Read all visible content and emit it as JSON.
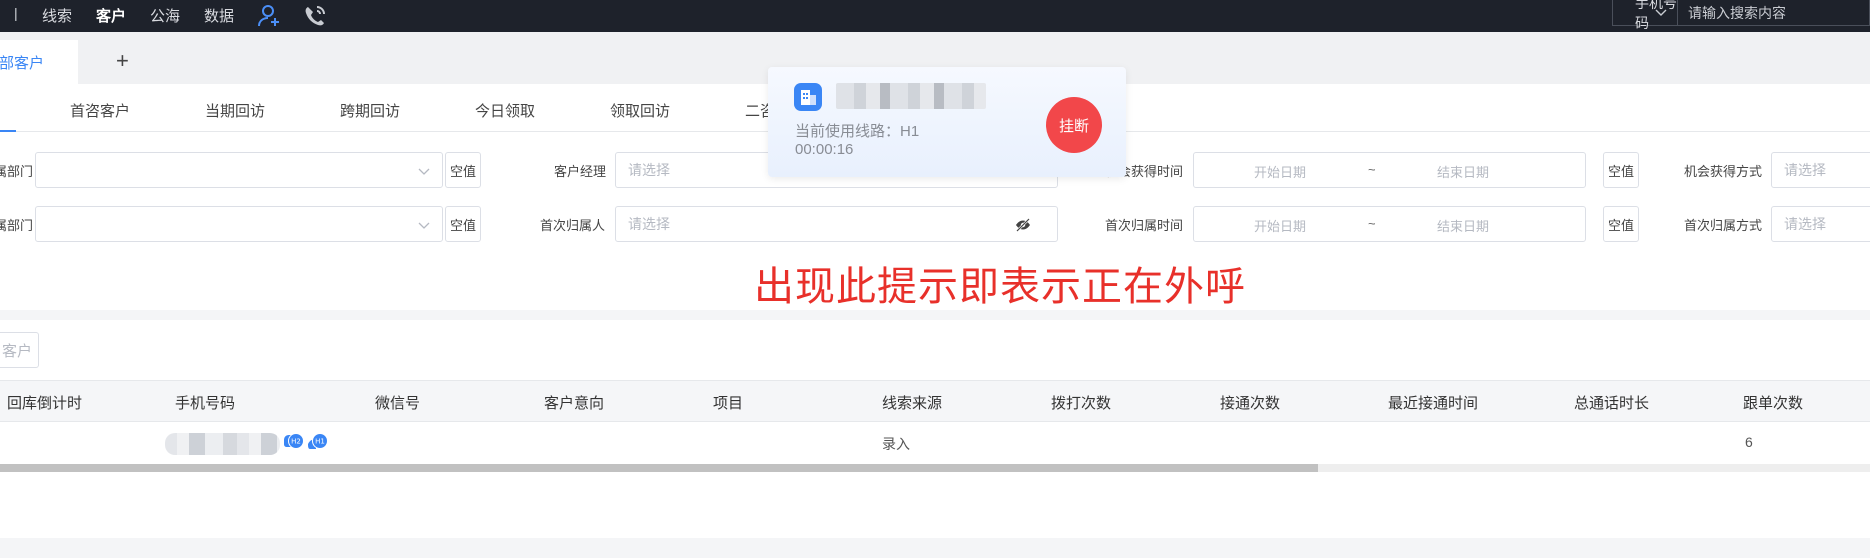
{
  "nav": {
    "separator": "|",
    "items": [
      "线索",
      "客户",
      "公海",
      "数据"
    ],
    "active": "客户"
  },
  "search": {
    "type_selected": "手机号码",
    "placeholder": "请输入搜索内容"
  },
  "tabs": {
    "active_label": "全部客户",
    "add_label": "+"
  },
  "subtabs": [
    "首咨客户",
    "当期回访",
    "跨期回访",
    "今日领取",
    "领取回访",
    "二咨"
  ],
  "filters": {
    "row1": {
      "dept_label": "属部门",
      "null_label": "空值",
      "manager_label": "客户经理",
      "manager_placeholder": "请选择",
      "time_label": "机会获得时间",
      "start_placeholder": "开始日期",
      "tilde": "~",
      "end_placeholder": "结束日期",
      "null_label_2": "空值",
      "method_label": "机会获得方式",
      "method_placeholder": "请选择"
    },
    "row2": {
      "dept_label": "属部门",
      "null_label": "空值",
      "owner_label": "首次归属人",
      "owner_placeholder": "请选择",
      "time_label": "首次归属时间",
      "start_placeholder": "开始日期",
      "tilde": "~",
      "end_placeholder": "结束日期",
      "null_label_2": "空值",
      "method_label": "首次归属方式",
      "method_placeholder": "请选择"
    }
  },
  "call_popup": {
    "line_text": "当前使用线路：H1",
    "timer": "00:00:16",
    "hangup_label": "挂断"
  },
  "annotation": "出现此提示即表示正在外呼",
  "table": {
    "add_button": "客户",
    "columns": [
      "回库倒计时",
      "手机号码",
      "微信号",
      "客户意向",
      "项目",
      "线索来源",
      "拨打次数",
      "接通次数",
      "最近接通时间",
      "总通话时长",
      "跟单次数"
    ],
    "rows": [
      {
        "source": "录入",
        "follow_count": "6",
        "badges": [
          "H2",
          "H1"
        ]
      }
    ],
    "scroll_fraction": 0.705
  },
  "colors": {
    "topbar": "#1e222b",
    "accent": "#3a86f5",
    "hangup": "#f2474a",
    "annotation": "#e8302a"
  }
}
